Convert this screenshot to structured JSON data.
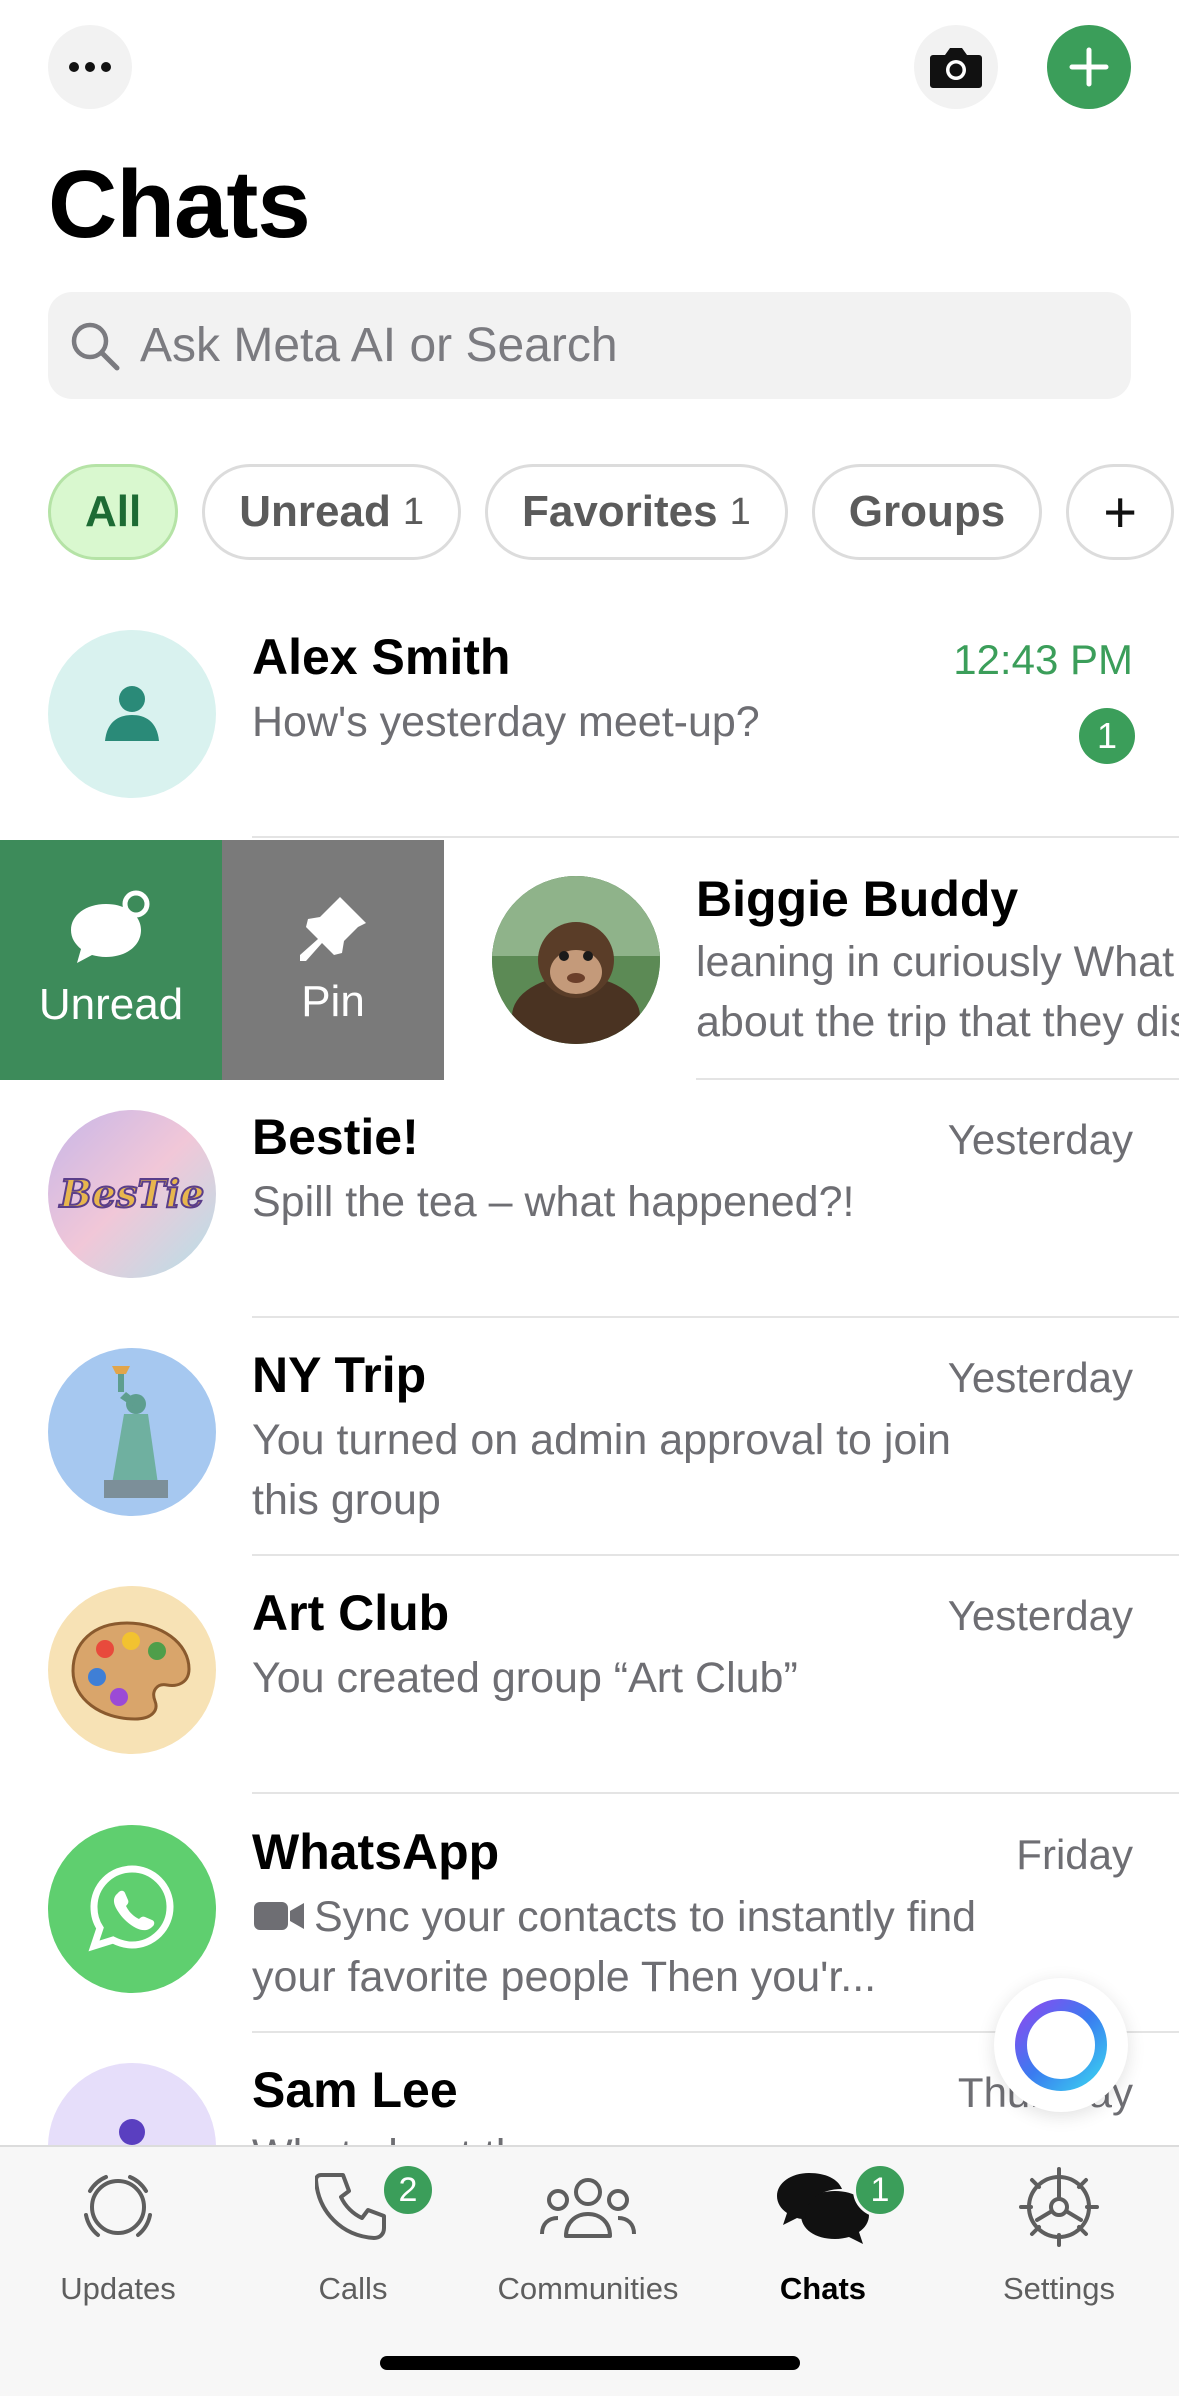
{
  "header": {
    "title": "Chats"
  },
  "search": {
    "placeholder": "Ask Meta AI or Search"
  },
  "filters": [
    {
      "label": "All",
      "count": ""
    },
    {
      "label": "Unread",
      "count": "1"
    },
    {
      "label": "Favorites",
      "count": "1"
    },
    {
      "label": "Groups",
      "count": ""
    },
    {
      "label": "+",
      "count": ""
    }
  ],
  "swipe_actions": {
    "unread": "Unread",
    "pin": "Pin"
  },
  "chats": [
    {
      "name": "Alex Smith",
      "time": "12:43 PM",
      "preview": "How's yesterday meet-up?",
      "unread": "1"
    },
    {
      "name": "Biggie Buddy",
      "time": "",
      "preview": "leaning in curiously What was it about the trip that they disagreed on?"
    },
    {
      "name": "Bestie!",
      "time": "Yesterday",
      "preview": "Spill the tea – what happened?!"
    },
    {
      "name": "NY Trip",
      "time": "Yesterday",
      "preview": "You turned on admin approval to join this group"
    },
    {
      "name": "Art Club",
      "time": "Yesterday",
      "preview": "You created group “Art Club”"
    },
    {
      "name": "WhatsApp",
      "time": "Friday",
      "preview": "Sync your contacts to instantly find your favorite people Then you'r..."
    },
    {
      "name": "Sam Lee",
      "time": "Thursday",
      "preview": "What about the ..."
    }
  ],
  "tabs": [
    {
      "label": "Updates",
      "badge": ""
    },
    {
      "label": "Calls",
      "badge": "2"
    },
    {
      "label": "Communities",
      "badge": ""
    },
    {
      "label": "Chats",
      "badge": "1"
    },
    {
      "label": "Settings",
      "badge": ""
    }
  ],
  "colors": {
    "accent": "#3b9e5a",
    "unread_action": "#3d8b5a",
    "pin_action": "#7a7a7a",
    "chip_active_bg": "#d9f8cf"
  },
  "icons": [
    "more-icon",
    "camera-icon",
    "plus-icon",
    "search-icon",
    "unread-chat-icon",
    "pin-icon",
    "video-icon",
    "meta-ai-icon",
    "updates-icon",
    "calls-icon",
    "communities-icon",
    "chats-icon",
    "settings-icon"
  ]
}
